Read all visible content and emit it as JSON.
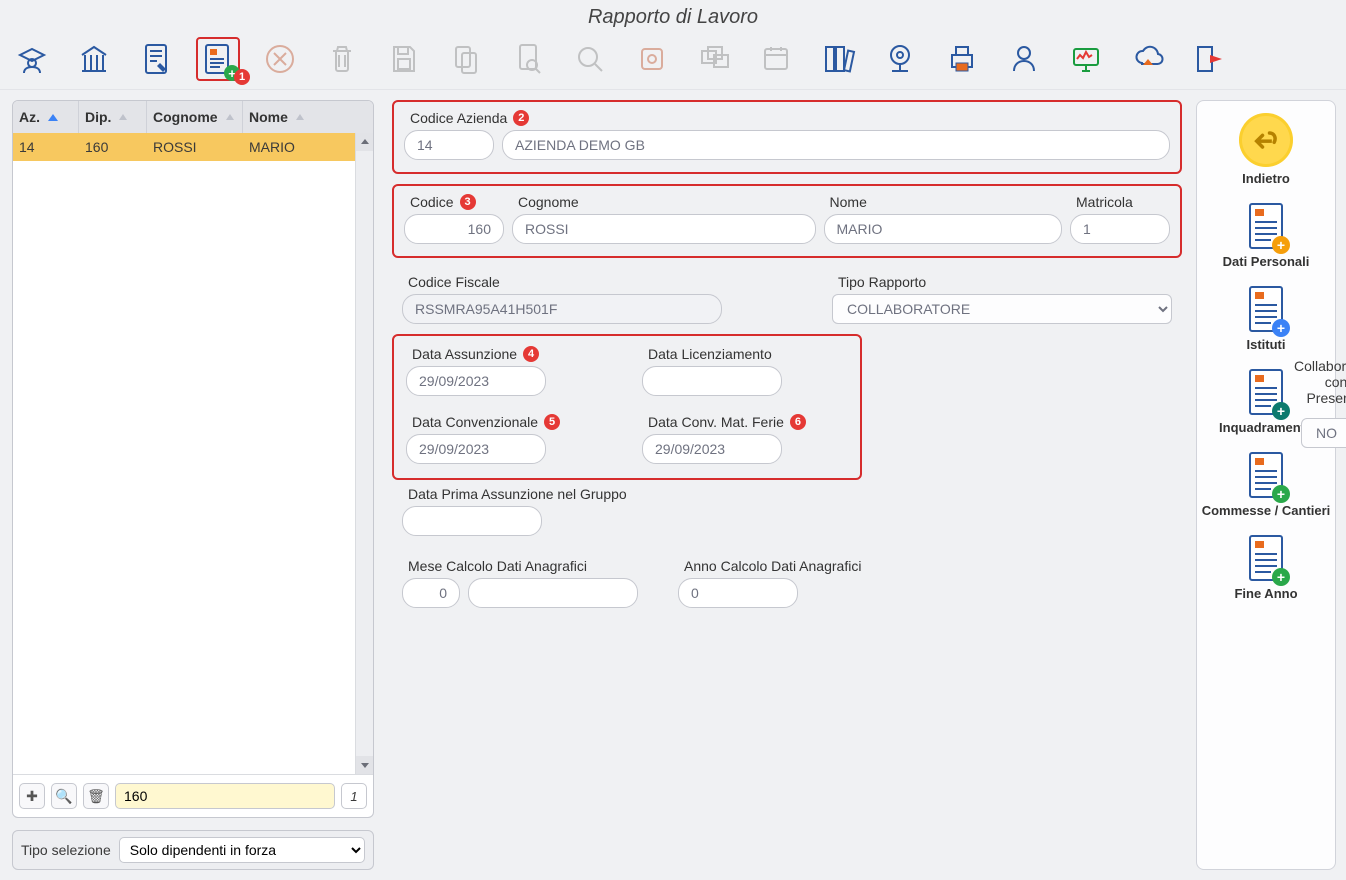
{
  "title": "Rapporto di Lavoro",
  "toolbar_badge": "1",
  "grid": {
    "headers": {
      "az": "Az.",
      "dip": "Dip.",
      "cognome": "Cognome",
      "nome": "Nome"
    },
    "row": {
      "az": "14",
      "dip": "160",
      "cognome": "ROSSI",
      "nome": "MARIO"
    },
    "filter_value": "160",
    "count": "1",
    "sel_label": "Tipo selezione",
    "sel_value": "Solo dipendenti in forza"
  },
  "codice_azienda": {
    "label": "Codice Azienda",
    "badge": "2",
    "code": "14",
    "name": "AZIENDA DEMO GB"
  },
  "dip": {
    "codice_label": "Codice",
    "codice_badge": "3",
    "codice_val": "160",
    "cognome_label": "Cognome",
    "cognome_val": "ROSSI",
    "nome_label": "Nome",
    "nome_val": "MARIO",
    "matricola_label": "Matricola",
    "matricola_val": "1"
  },
  "cf": {
    "label": "Codice Fiscale",
    "val": "RSSMRA95A41H501F"
  },
  "tipo_rapporto": {
    "label": "Tipo Rapporto",
    "val": "COLLABORATORE"
  },
  "dates": {
    "assunzione_label": "Data Assunzione",
    "assunzione_badge": "4",
    "assunzione_val": "29/09/2023",
    "licenziamento_label": "Data Licenziamento",
    "licenziamento_val": "",
    "convenzionale_label": "Data Convenzionale",
    "convenzionale_badge": "5",
    "convenzionale_val": "29/09/2023",
    "matferie_label": "Data Conv. Mat. Ferie",
    "matferie_badge": "6",
    "matferie_val": "29/09/2023"
  },
  "collab": {
    "label": "Collaboratore con Presenze",
    "val": "NO"
  },
  "gruppo": {
    "label": "Data Prima Assunzione nel Gruppo",
    "val": ""
  },
  "calc": {
    "mese_label": "Mese Calcolo Dati Anagrafici",
    "mese_val": "0",
    "mese_desc": "",
    "anno_label": "Anno Calcolo Dati Anagrafici",
    "anno_val": "0"
  },
  "nav": {
    "indietro": "Indietro",
    "dati_personali": "Dati Personali",
    "istituti": "Istituti",
    "inquadramento": "Inquadramento",
    "commesse": "Commesse / Cantieri",
    "fine_anno": "Fine Anno"
  }
}
